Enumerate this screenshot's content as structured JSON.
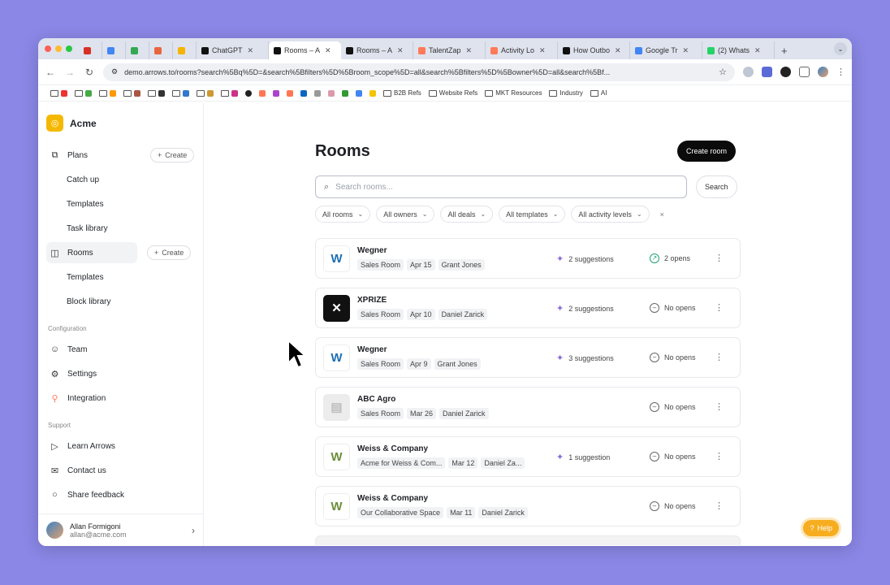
{
  "browser": {
    "tabs": [
      {
        "title": "",
        "color": "#d93025",
        "icon": "gmail-icon"
      },
      {
        "title": "",
        "color": "#4285f4",
        "icon": "calendar-icon"
      },
      {
        "title": "",
        "color": "#34a853",
        "icon": "sheets-icon"
      },
      {
        "title": "",
        "color": "#e8663d",
        "icon": "app-icon"
      },
      {
        "title": "",
        "color": "#f4b400",
        "icon": "drive-icon"
      },
      {
        "title": "ChatGPT",
        "color": "#111111",
        "icon": "chatgpt-icon"
      },
      {
        "title": "Rooms – A",
        "color": "#111111",
        "icon": "arrows-icon",
        "active": true
      },
      {
        "title": "Rooms – A",
        "color": "#111111",
        "icon": "arrows-icon"
      },
      {
        "title": "TalentZap",
        "color": "#ff7a59",
        "icon": "hubspot-icon"
      },
      {
        "title": "Activity Lo",
        "color": "#ff7a59",
        "icon": "asterisk-icon"
      },
      {
        "title": "How Outbo",
        "color": "#111111",
        "icon": "arrows-icon"
      },
      {
        "title": "Google Tr",
        "color": "#4285f4",
        "icon": "translate-icon"
      },
      {
        "title": "(2) Whats",
        "color": "#25d366",
        "icon": "whatsapp-icon"
      }
    ],
    "url": "demo.arrows.to/rooms?search%5Bq%5D=&search%5Bfilters%5D%5Broom_scope%5D=all&search%5Bfilters%5D%5Bowner%5D=all&search%5Bf...",
    "bookmarks": [
      {
        "label": "B2B Refs"
      },
      {
        "label": "Website Refs"
      },
      {
        "label": "MKT Resources"
      },
      {
        "label": "Industry"
      },
      {
        "label": "AI"
      }
    ]
  },
  "sidebar": {
    "org_name": "Acme",
    "plans_label": "Plans",
    "create_label": "Create",
    "plans_sub": [
      "Catch up",
      "Templates",
      "Task library"
    ],
    "rooms_label": "Rooms",
    "rooms_sub": [
      "Templates",
      "Block library"
    ],
    "configuration_label": "Configuration",
    "configuration_items": [
      "Team",
      "Settings",
      "Integration"
    ],
    "support_label": "Support",
    "support_items": [
      "Learn Arrows",
      "Contact us",
      "Share feedback"
    ],
    "user": {
      "name": "Allan Formigoni",
      "email": "allan@acme.com"
    }
  },
  "main": {
    "title": "Rooms",
    "create_button": "Create room",
    "search_placeholder": "Search rooms...",
    "search_button": "Search",
    "filters": [
      "All rooms",
      "All owners",
      "All deals",
      "All templates",
      "All activity levels"
    ],
    "clear_filter": "×",
    "rooms": [
      {
        "name": "Wegner",
        "tags": [
          "Sales Room",
          "Apr 15",
          "Grant Jones"
        ],
        "suggestions": "2 suggestions",
        "opens": "2 opens",
        "opened": true,
        "logo": "W",
        "logo_color": "#1f6fb2",
        "logo_bg": "#ffffff"
      },
      {
        "name": "XPRIZE",
        "tags": [
          "Sales Room",
          "Apr 10",
          "Daniel Zarick"
        ],
        "suggestions": "2 suggestions",
        "opens": "No opens",
        "opened": false,
        "logo": "✕",
        "logo_color": "#ffffff",
        "logo_bg": "#111111"
      },
      {
        "name": "Wegner",
        "tags": [
          "Sales Room",
          "Apr 9",
          "Grant Jones"
        ],
        "suggestions": "3 suggestions",
        "opens": "No opens",
        "opened": false,
        "logo": "W",
        "logo_color": "#1f6fb2",
        "logo_bg": "#ffffff"
      },
      {
        "name": "ABC Agro",
        "tags": [
          "Sales Room",
          "Mar 26",
          "Daniel Zarick"
        ],
        "suggestions": "",
        "opens": "No opens",
        "opened": false,
        "logo": "▤",
        "logo_color": "#bdbdbd",
        "logo_bg": "#ececec"
      },
      {
        "name": "Weiss & Company",
        "tags": [
          "Acme for Weiss & Com...",
          "Mar 12",
          "Daniel Za..."
        ],
        "suggestions": "1 suggestion",
        "opens": "No opens",
        "opened": false,
        "logo": "W",
        "logo_color": "#6b8f3a",
        "logo_bg": "#ffffff"
      },
      {
        "name": "Weiss & Company",
        "tags": [
          "Our Collaborative Space",
          "Mar 11",
          "Daniel Zarick"
        ],
        "suggestions": "",
        "opens": "No opens",
        "opened": false,
        "logo": "W",
        "logo_color": "#6b8f3a",
        "logo_bg": "#ffffff"
      }
    ],
    "help_label": "Help"
  },
  "colors": {
    "background": "#8a87e6",
    "accent": "#0b0b0b",
    "help": "#f6ad1f",
    "suggestion": "#8c6ad8",
    "opened": "#20a074"
  }
}
